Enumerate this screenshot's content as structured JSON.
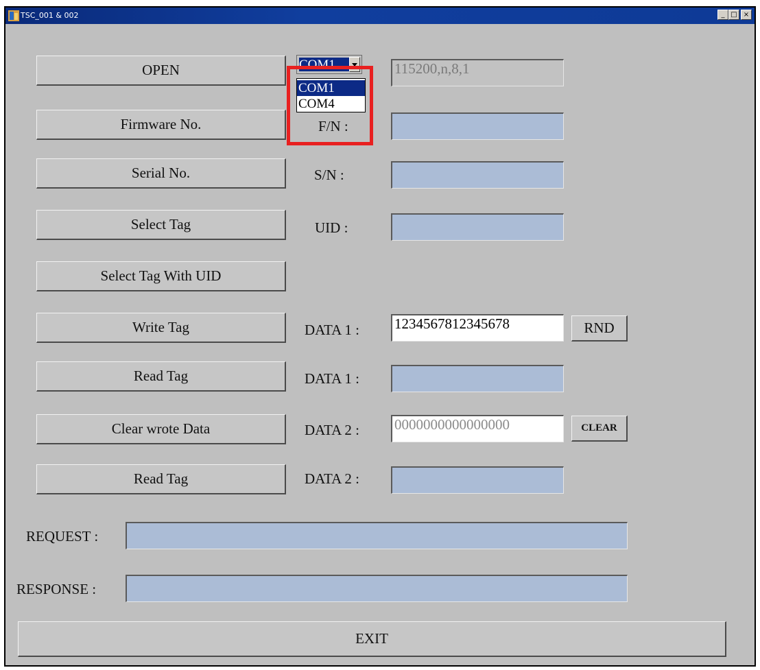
{
  "window": {
    "title": "TSC_001 & 002",
    "controls": {
      "minimize": "_",
      "maximize": "□",
      "close": "×"
    }
  },
  "buttons": {
    "open": "OPEN",
    "firmware": "Firmware No.",
    "serial": "Serial No.",
    "select_tag": "Select Tag",
    "select_tag_uid": "Select Tag With UID",
    "write_tag": "Write Tag",
    "read_tag_1": "Read Tag",
    "clear_wrote": "Clear wrote Data",
    "read_tag_2": "Read Tag",
    "rnd": "RND",
    "clear": "CLEAR",
    "exit": "EXIT"
  },
  "port": {
    "selected": "COM1",
    "options": [
      "COM1",
      "COM4"
    ],
    "settings": "115200,n,8,1"
  },
  "labels": {
    "fn": "F/N :",
    "sn": "S/N :",
    "uid": "UID :",
    "data1_write": "DATA 1 :",
    "data1_read": "DATA 1 :",
    "data2_write": "DATA 2 :",
    "data2_read": "DATA 2 :",
    "request": "REQUEST :",
    "response": "RESPONSE :"
  },
  "values": {
    "data1_write": "1234567812345678",
    "data2_write": "0000000000000000"
  }
}
